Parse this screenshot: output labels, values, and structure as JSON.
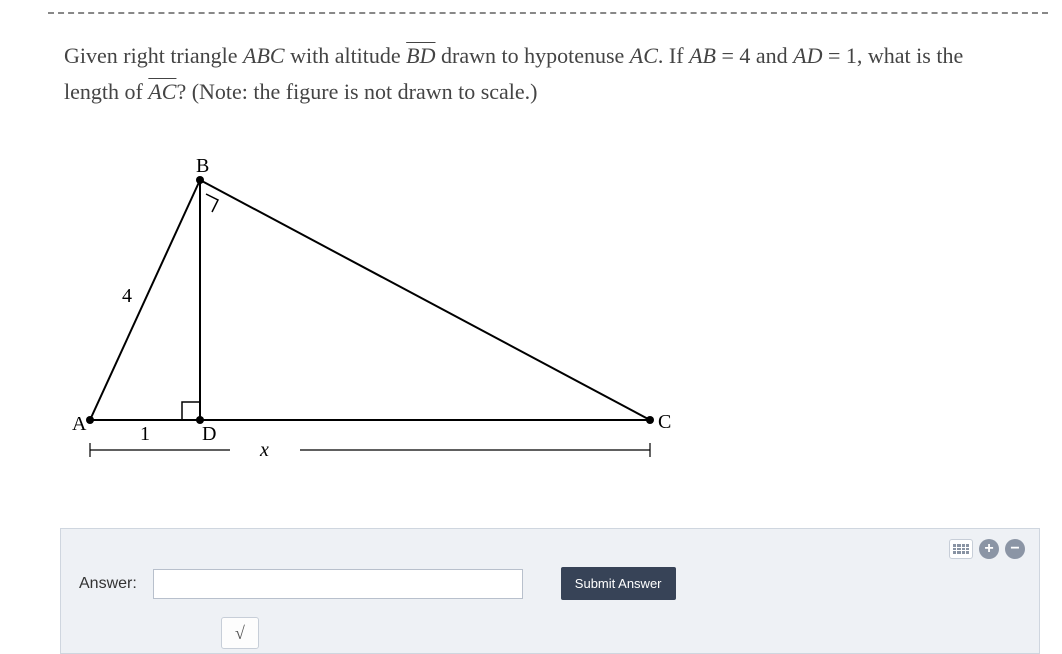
{
  "question": {
    "part1": "Given right triangle ",
    "tri": "ABC",
    "part2": " with altitude ",
    "alt": "BD",
    "part3": " drawn to hypotenuse ",
    "hyp1": "AC",
    "part4": ". If ",
    "eq1_left": "AB",
    "eq1_eq": " = ",
    "eq1_right": "4",
    "part5": " and ",
    "eq2_left": "AD",
    "eq2_eq": " = ",
    "eq2_right": "1",
    "part6": ", what is the length of ",
    "hyp2": "AC",
    "part7": "? (Note: the figure is not drawn to scale.)"
  },
  "figure": {
    "label_A": "A",
    "label_B": "B",
    "label_C": "C",
    "label_D": "D",
    "label_AB": "4",
    "label_AD": "1",
    "label_x": "x"
  },
  "answer": {
    "label": "Answer:",
    "value": "",
    "placeholder": "",
    "submit": "Submit Answer",
    "sqrt": "√"
  }
}
